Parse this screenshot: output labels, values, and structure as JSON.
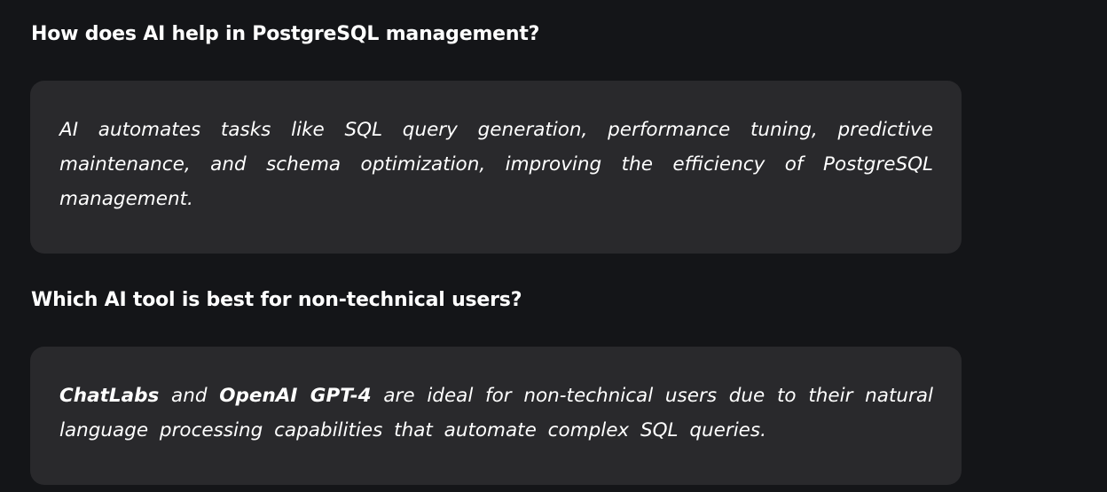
{
  "faq": [
    {
      "question": "How does AI help in PostgreSQL management?",
      "answer": "AI automates tasks like SQL query generation, performance tuning, predictive maintenance, and schema optimization, improving the efficiency of PostgreSQL management."
    },
    {
      "question": "Which AI tool is best for non-technical users?",
      "answer_strong_1": "ChatLabs",
      "answer_mid": " and ",
      "answer_strong_2": "OpenAI GPT-4",
      "answer_rest": " are ideal for non-technical users due to their natural language processing capabilities that automate complex SQL queries."
    }
  ],
  "colors": {
    "background": "#141518",
    "card": "#29292c",
    "text": "#ffffff"
  }
}
